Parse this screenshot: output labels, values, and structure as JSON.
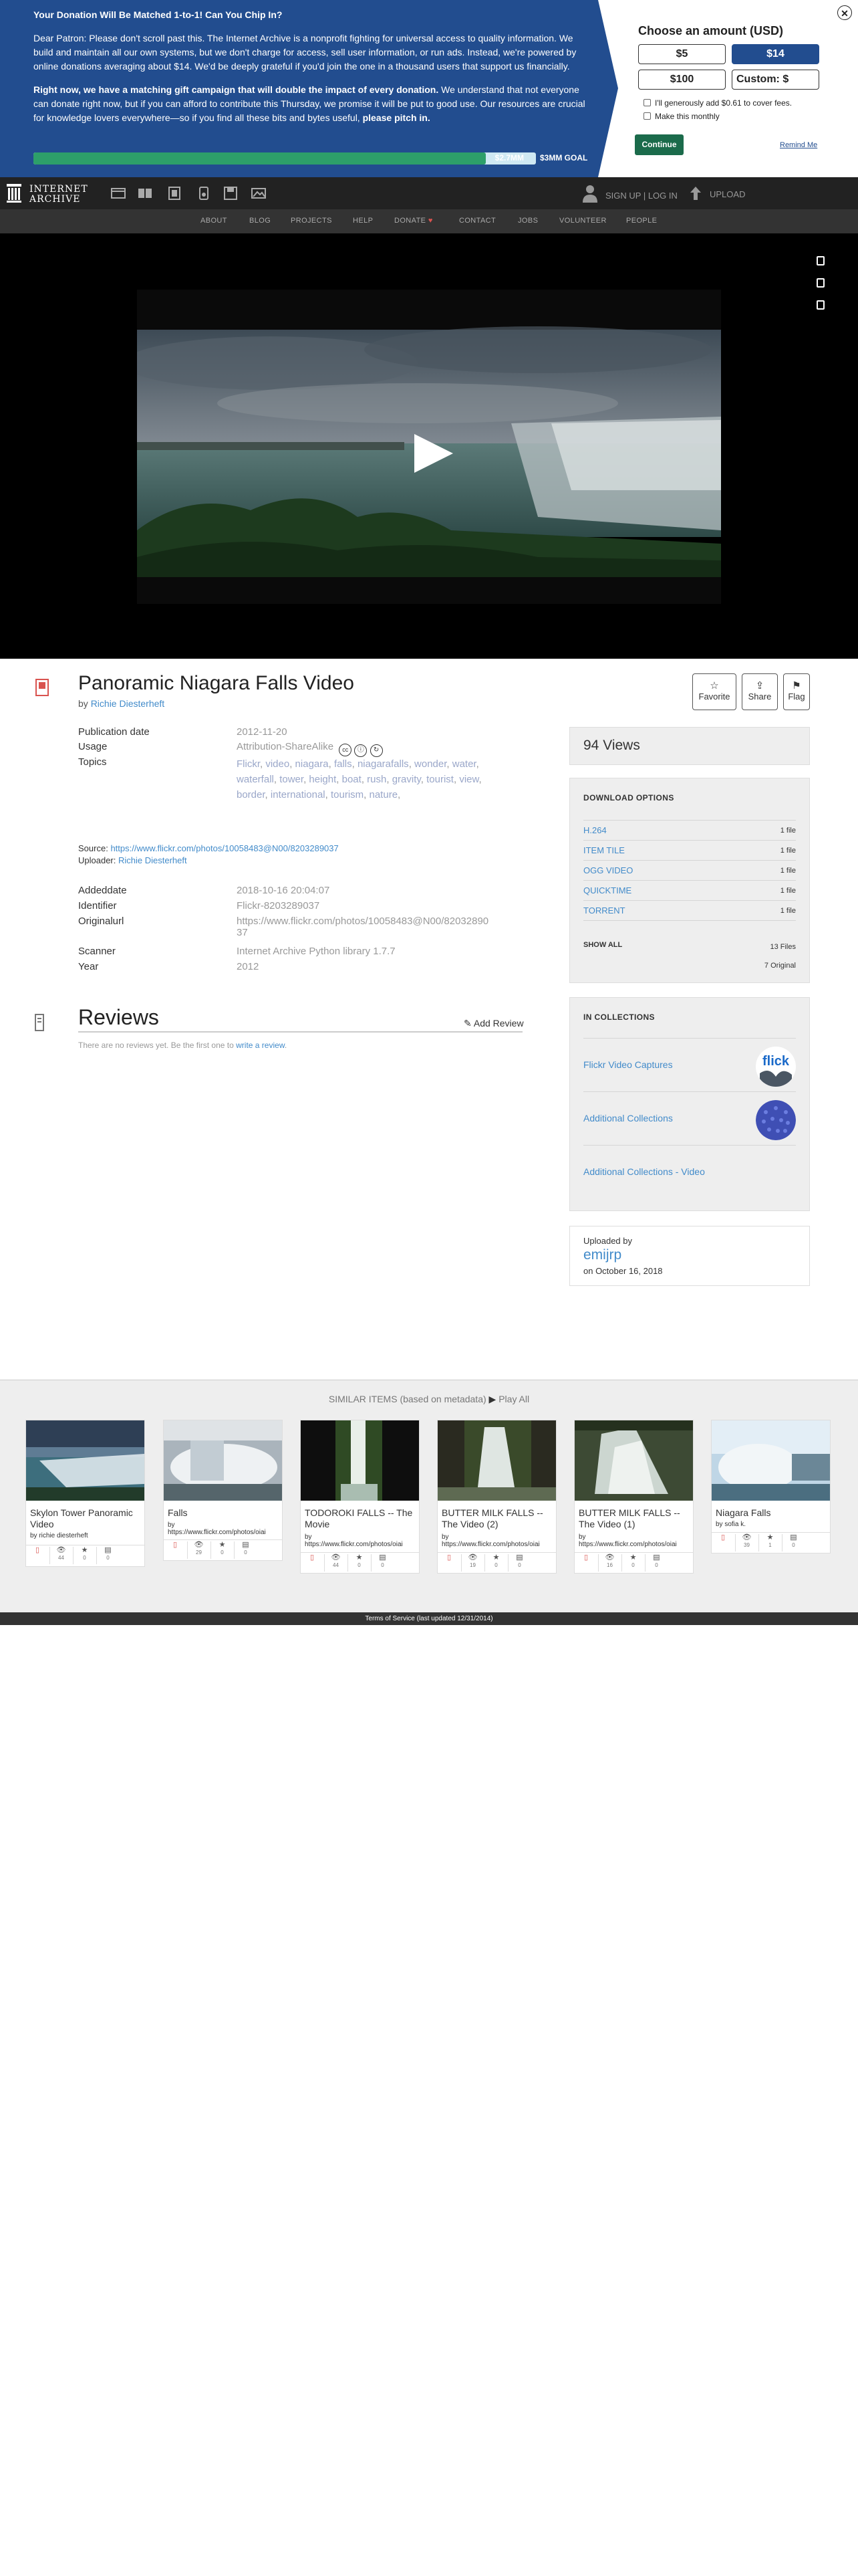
{
  "banner": {
    "heading": "Your Donation Will Be Matched 1-to-1! Can You Chip In?",
    "para1": "Dear Patron: Please don't scroll past this. The Internet Archive is a nonprofit fighting for universal access to quality information. We build and maintain all our own systems, but we don't charge for access, sell user information, or run ads. Instead, we're powered by online donations averaging about $14. We'd be deeply grateful if you'd join the one in a thousand users that support us financially.",
    "para2_bold": "Right now, we have a matching gift campaign that will double the impact of every donation.",
    "para2_rest": " We understand that not everyone can donate right now, but if you can afford to contribute this Thursday, we promise it will be put to good use. Our resources are crucial for knowledge lovers everywhere—so if you find all these bits and bytes useful, ",
    "para2_end": "please pitch in.",
    "raised": "$2.7MM",
    "goal": "$3MM GOAL",
    "progress_fraction": 0.9,
    "choose_title": "Choose an amount (USD)",
    "amounts": [
      "$5",
      "$14",
      "$100",
      "Custom: $"
    ],
    "selected_amount": "$14",
    "cover_fees": "I'll generously add $0.61 to cover fees.",
    "monthly": "Make this monthly",
    "continue": "Continue",
    "remind": "Remind Me",
    "close_icon": "close-icon"
  },
  "topnav": {
    "logo_line1": "INTERNET",
    "logo_line2": "ARCHIVE",
    "signup": "SIGN UP | LOG IN",
    "upload": "UPLOAD"
  },
  "subnav": [
    "ABOUT",
    "BLOG",
    "PROJECTS",
    "HELP",
    "DONATE",
    "CONTACT",
    "JOBS",
    "VOLUNTEER",
    "PEOPLE"
  ],
  "item": {
    "title": "Panoramic Niagara Falls Video",
    "by_label": "by",
    "author": "Richie Diesterheft",
    "actions": [
      "Favorite",
      "Share",
      "Flag"
    ],
    "meta": [
      {
        "label": "Publication date",
        "value": "2012-11-20"
      },
      {
        "label": "Usage",
        "value": "Attribution-ShareAlike"
      },
      {
        "label": "Topics",
        "value": ""
      }
    ],
    "topics": [
      "Flickr",
      "video",
      "niagara",
      "falls",
      "niagarafalls",
      "wonder",
      "water",
      "waterfall",
      "tower",
      "height",
      "boat",
      "rush",
      "gravity",
      "tourist",
      "view",
      "border",
      "international",
      "tourism",
      "nature"
    ],
    "source_label": "Source:",
    "source_url": "https://www.flickr.com/photos/10058483@N00/8203289037",
    "uploader_label": "Uploader:",
    "uploader": "Richie Diesterheft",
    "meta2": [
      {
        "label": "Addeddate",
        "value": "2018-10-16 20:04:07"
      },
      {
        "label": "Identifier",
        "value": "Flickr-8203289037"
      },
      {
        "label": "Originalurl",
        "value": "https://www.flickr.com/photos/10058483@N00/82032890",
        "value2": "37"
      },
      {
        "label": "Scanner",
        "value": "Internet Archive Python library 1.7.7"
      },
      {
        "label": "Year",
        "value": "2012"
      }
    ]
  },
  "reviews": {
    "title": "Reviews",
    "add": "Add Review",
    "none_text": "There are no reviews yet. Be the first one to ",
    "none_link": "write a review",
    "none_end": "."
  },
  "sidebar": {
    "views": "94 Views",
    "download_title": "DOWNLOAD OPTIONS",
    "downloads": [
      {
        "name": "H.264",
        "count": "1 file"
      },
      {
        "name": "ITEM TILE",
        "count": "1 file"
      },
      {
        "name": "OGG VIDEO",
        "count": "1 file"
      },
      {
        "name": "QUICKTIME",
        "count": "1 file"
      },
      {
        "name": "TORRENT",
        "count": "1 file"
      }
    ],
    "show_all": "SHOW ALL",
    "files": "13 Files",
    "original": "7 Original",
    "collections_title": "IN COLLECTIONS",
    "collections": [
      "Flickr Video Captures",
      "Additional Collections",
      "Additional Collections - Video"
    ],
    "uploaded_by_label": "Uploaded by",
    "uploaded_by": "emijrp",
    "uploaded_on": "on October 16, 2018"
  },
  "similar": {
    "heading": "SIMILAR ITEMS (based on metadata)",
    "play_all": "Play All",
    "cards": [
      {
        "title": "Skylon Tower Panoramic Video",
        "by": "by richie diesterheft",
        "stats": [
          "",
          "44",
          "0",
          "0"
        ]
      },
      {
        "title": "Falls",
        "by": "by",
        "by2": "https://www.flickr.com/photos/oiai",
        "stats": [
          "",
          "29",
          "0",
          "0"
        ]
      },
      {
        "title": "TODOROKI FALLS -- The Movie",
        "by": "by",
        "by2": "https://www.flickr.com/photos/oiai",
        "stats": [
          "",
          "44",
          "0",
          "0"
        ]
      },
      {
        "title": "BUTTER MILK FALLS -- The Video (2)",
        "by": "by",
        "by2": "https://www.flickr.com/photos/oiai",
        "stats": [
          "",
          "19",
          "0",
          "0"
        ]
      },
      {
        "title": "BUTTER MILK FALLS -- The Video (1)",
        "by": "by",
        "by2": "https://www.flickr.com/photos/oiai",
        "stats": [
          "",
          "16",
          "0",
          "0"
        ]
      },
      {
        "title": "Niagara Falls",
        "by": "by sofia k.",
        "stats": [
          "",
          "39",
          "1",
          "0"
        ]
      }
    ]
  },
  "footer": "Terms of Service (last updated 12/31/2014)"
}
